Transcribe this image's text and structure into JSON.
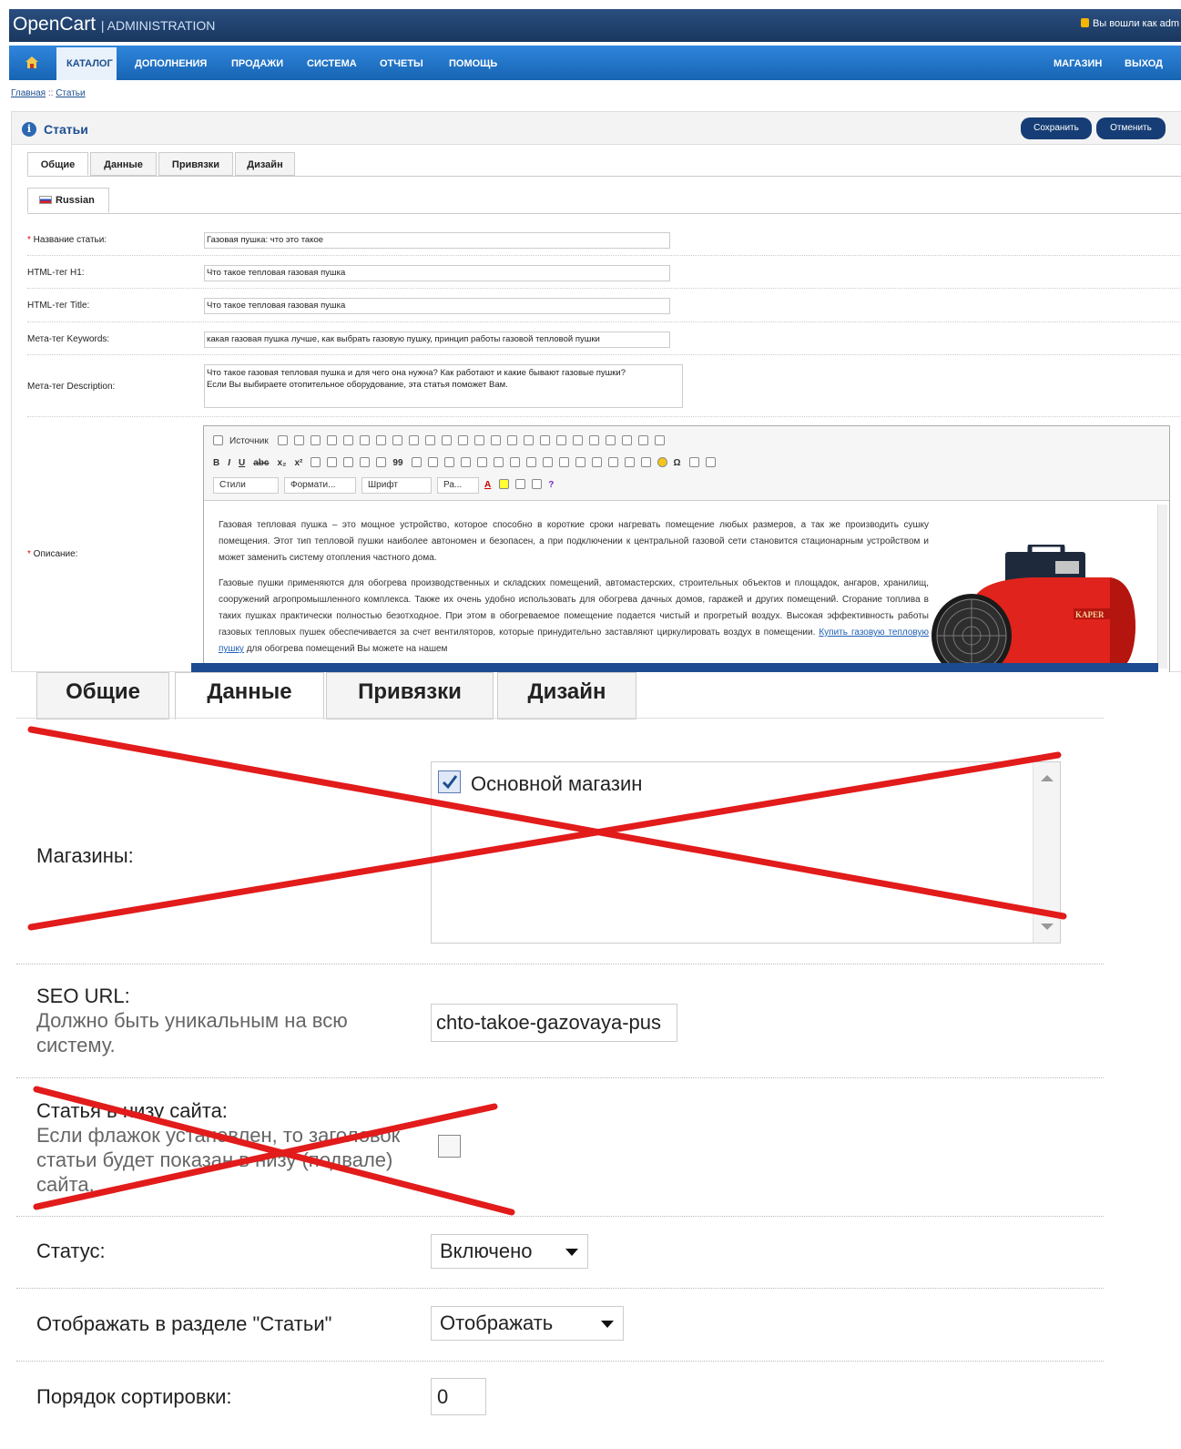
{
  "header": {
    "logo": "OpenCart",
    "logo_sub": "| ADMINISTRATION",
    "login_text": "Вы вошли как adm"
  },
  "menu": {
    "items": [
      "КАТАЛОГ",
      "ДОПОЛНЕНИЯ",
      "ПРОДАЖИ",
      "СИСТЕМА",
      "ОТЧЕТЫ",
      "ПОМОЩЬ"
    ],
    "right": [
      "МАГАЗИН",
      "ВЫХОД"
    ]
  },
  "breadcrumb": {
    "home": "Главная",
    "sep": " :: ",
    "current": "Статьи"
  },
  "page": {
    "title": "Статьи",
    "save": "Сохранить",
    "cancel": "Отменить"
  },
  "tabs": [
    "Общие",
    "Данные",
    "Привязки",
    "Дизайн"
  ],
  "language_tab": "Russian",
  "form": {
    "name_label": "Название статьи:",
    "name_value": "Газовая пушка: что это такое",
    "h1_label": "HTML-тег H1:",
    "h1_value": "Что такое тепловая газовая пушка",
    "title_label": "HTML-тег Title:",
    "title_value": "Что такое тепловая газовая пушка",
    "keywords_label": "Мета-тег Keywords:",
    "keywords_value": "какая газовая пушка лучше, как выбрать газовую пушку, принцип работы газовой тепловой пушки",
    "description_label": "Мета-тег Description:",
    "description_line1": "Что такое газовая тепловая пушка и для чего она нужна? Как работают и какие бывают газовые пушки?",
    "description_line2": "Если Вы выбираете отопительное оборудование, эта статья поможет Вам.",
    "body_label": "Описание:"
  },
  "editor": {
    "source": "Источник",
    "styles": "Стили",
    "format": "Формати...",
    "font": "Шрифт",
    "size": "Ра...",
    "p1": "Газовая тепловая пушка – это мощное устройство, которое способно в короткие сроки нагревать помещение любых размеров, а так же производить сушку помещения. Этот тип тепловой пушки наиболее автономен и безопасен, а при подключении к центральной газовой сети становится стационарным устройством и может заменить систему отопления частного дома.",
    "p2": "Газовые пушки применяются для обогрева производственных и складских помещений, автомастерских, строительных объектов и площадок, ангаров, хранилищ, сооружений агропромышленного комплекса. Также их очень удобно использовать для обогрева дачных домов, гаражей и других помещений. Сгорание топлива в таких пушках практически полностью безотходное. При этом в обогреваемое помещение подается чистый и прогретый воздух. Высокая эффективность работы газовых тепловых пушек обеспечивается за счет вентиляторов, которые принудительно заставляют циркулировать воздух в помещении.",
    "link": "Купить газовую тепловую пушку",
    "p2_tail": "для обогрева помещений Вы можете на нашем",
    "heater_brand": "KAPER"
  },
  "data_tab": {
    "stores_label": "Магазины:",
    "store_name": "Основной магазин",
    "seo_label": "SEO URL:",
    "seo_hint": "Должно быть уникальным на всю систему.",
    "seo_value": "chto-takoe-gazovaya-pus",
    "footer_label": "Статья в низу сайта:",
    "footer_hint": "Если флажок установлен, то заголовок статьи будет показан в низу (подвале) сайта.",
    "status_label": "Статус:",
    "status_value": "Включено",
    "show_label": "Отображать в разделе \"Статьи\"",
    "show_value": "Отображать",
    "sort_label": "Порядок сортировки:",
    "sort_value": "0"
  },
  "colors": {
    "header": "#1c3d66",
    "menu": "#1f6fc4",
    "button": "#163d75",
    "cross": "#e21b1b"
  }
}
